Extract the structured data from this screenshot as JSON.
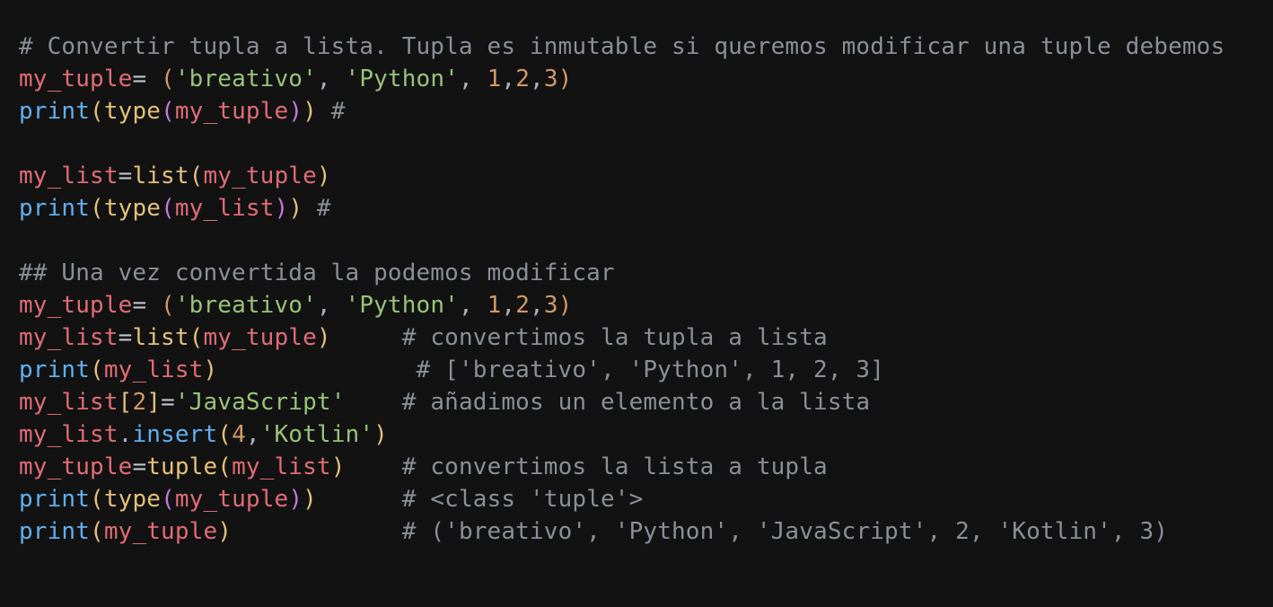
{
  "colors": {
    "background": "#121212",
    "variable": "#e06c75",
    "operator": "#c0c4cc",
    "function": "#e5c07b",
    "builtin": "#61afef",
    "paren": "#c678dd",
    "string": "#98c379",
    "number": "#d19a66",
    "comment": "#8a8f98",
    "punct": "#abb2bf"
  },
  "lines": [
    [
      {
        "t": "# Convertir tupla a lista. Tupla es inmutable si queremos modificar una tuple debemos",
        "c": "comment"
      }
    ],
    [
      {
        "t": "my_tuple",
        "c": "variable"
      },
      {
        "t": "= ",
        "c": "operator"
      },
      {
        "t": "(",
        "c": "number"
      },
      {
        "t": "'breativo'",
        "c": "string"
      },
      {
        "t": ", ",
        "c": "punct"
      },
      {
        "t": "'Python'",
        "c": "string"
      },
      {
        "t": ", ",
        "c": "punct"
      },
      {
        "t": "1",
        "c": "number"
      },
      {
        "t": ",",
        "c": "punct"
      },
      {
        "t": "2",
        "c": "number"
      },
      {
        "t": ",",
        "c": "punct"
      },
      {
        "t": "3",
        "c": "number"
      },
      {
        "t": ")",
        "c": "number"
      }
    ],
    [
      {
        "t": "print",
        "c": "builtin"
      },
      {
        "t": "(",
        "c": "function"
      },
      {
        "t": "type",
        "c": "function"
      },
      {
        "t": "(",
        "c": "paren"
      },
      {
        "t": "my_tuple",
        "c": "variable"
      },
      {
        "t": ")",
        "c": "paren"
      },
      {
        "t": ")",
        "c": "function"
      },
      {
        "t": " #",
        "c": "comment"
      }
    ],
    [],
    [
      {
        "t": "my_list",
        "c": "variable"
      },
      {
        "t": "=",
        "c": "operator"
      },
      {
        "t": "list",
        "c": "function"
      },
      {
        "t": "(",
        "c": "function"
      },
      {
        "t": "my_tuple",
        "c": "variable"
      },
      {
        "t": ")",
        "c": "function"
      }
    ],
    [
      {
        "t": "print",
        "c": "builtin"
      },
      {
        "t": "(",
        "c": "function"
      },
      {
        "t": "type",
        "c": "function"
      },
      {
        "t": "(",
        "c": "paren"
      },
      {
        "t": "my_list",
        "c": "variable"
      },
      {
        "t": ")",
        "c": "paren"
      },
      {
        "t": ")",
        "c": "function"
      },
      {
        "t": " #",
        "c": "comment"
      }
    ],
    [],
    [
      {
        "t": "## Una vez convertida la podemos modificar",
        "c": "comment"
      }
    ],
    [
      {
        "t": "my_tuple",
        "c": "variable"
      },
      {
        "t": "= ",
        "c": "operator"
      },
      {
        "t": "(",
        "c": "number"
      },
      {
        "t": "'breativo'",
        "c": "string"
      },
      {
        "t": ", ",
        "c": "punct"
      },
      {
        "t": "'Python'",
        "c": "string"
      },
      {
        "t": ", ",
        "c": "punct"
      },
      {
        "t": "1",
        "c": "number"
      },
      {
        "t": ",",
        "c": "punct"
      },
      {
        "t": "2",
        "c": "number"
      },
      {
        "t": ",",
        "c": "punct"
      },
      {
        "t": "3",
        "c": "number"
      },
      {
        "t": ")",
        "c": "number"
      }
    ],
    [
      {
        "t": "my_list",
        "c": "variable"
      },
      {
        "t": "=",
        "c": "operator"
      },
      {
        "t": "list",
        "c": "function"
      },
      {
        "t": "(",
        "c": "function"
      },
      {
        "t": "my_tuple",
        "c": "variable"
      },
      {
        "t": ")",
        "c": "function"
      },
      {
        "t": "     # convertimos la tupla a lista",
        "c": "comment"
      }
    ],
    [
      {
        "t": "print",
        "c": "builtin"
      },
      {
        "t": "(",
        "c": "function"
      },
      {
        "t": "my_list",
        "c": "variable"
      },
      {
        "t": ")",
        "c": "function"
      },
      {
        "t": "              # ['breativo', 'Python', 1, 2, 3]",
        "c": "comment"
      }
    ],
    [
      {
        "t": "my_list",
        "c": "variable"
      },
      {
        "t": "[",
        "c": "function"
      },
      {
        "t": "2",
        "c": "number"
      },
      {
        "t": "]",
        "c": "function"
      },
      {
        "t": "=",
        "c": "operator"
      },
      {
        "t": "'JavaScript'",
        "c": "string"
      },
      {
        "t": "    # añadimos un elemento a la lista",
        "c": "comment"
      }
    ],
    [
      {
        "t": "my_list",
        "c": "variable"
      },
      {
        "t": ".",
        "c": "punct"
      },
      {
        "t": "insert",
        "c": "builtin"
      },
      {
        "t": "(",
        "c": "function"
      },
      {
        "t": "4",
        "c": "number"
      },
      {
        "t": ",",
        "c": "punct"
      },
      {
        "t": "'Kotlin'",
        "c": "string"
      },
      {
        "t": ")",
        "c": "function"
      }
    ],
    [
      {
        "t": "my_tuple",
        "c": "variable"
      },
      {
        "t": "=",
        "c": "operator"
      },
      {
        "t": "tuple",
        "c": "function"
      },
      {
        "t": "(",
        "c": "function"
      },
      {
        "t": "my_list",
        "c": "variable"
      },
      {
        "t": ")",
        "c": "function"
      },
      {
        "t": "    # convertimos la lista a tupla",
        "c": "comment"
      }
    ],
    [
      {
        "t": "print",
        "c": "builtin"
      },
      {
        "t": "(",
        "c": "function"
      },
      {
        "t": "type",
        "c": "function"
      },
      {
        "t": "(",
        "c": "paren"
      },
      {
        "t": "my_tuple",
        "c": "variable"
      },
      {
        "t": ")",
        "c": "paren"
      },
      {
        "t": ")",
        "c": "function"
      },
      {
        "t": "      # <class 'tuple'>",
        "c": "comment"
      }
    ],
    [
      {
        "t": "print",
        "c": "builtin"
      },
      {
        "t": "(",
        "c": "function"
      },
      {
        "t": "my_tuple",
        "c": "variable"
      },
      {
        "t": ")",
        "c": "function"
      },
      {
        "t": "            # ('breativo', 'Python', 'JavaScript', 2, 'Kotlin', 3)",
        "c": "comment"
      }
    ]
  ]
}
